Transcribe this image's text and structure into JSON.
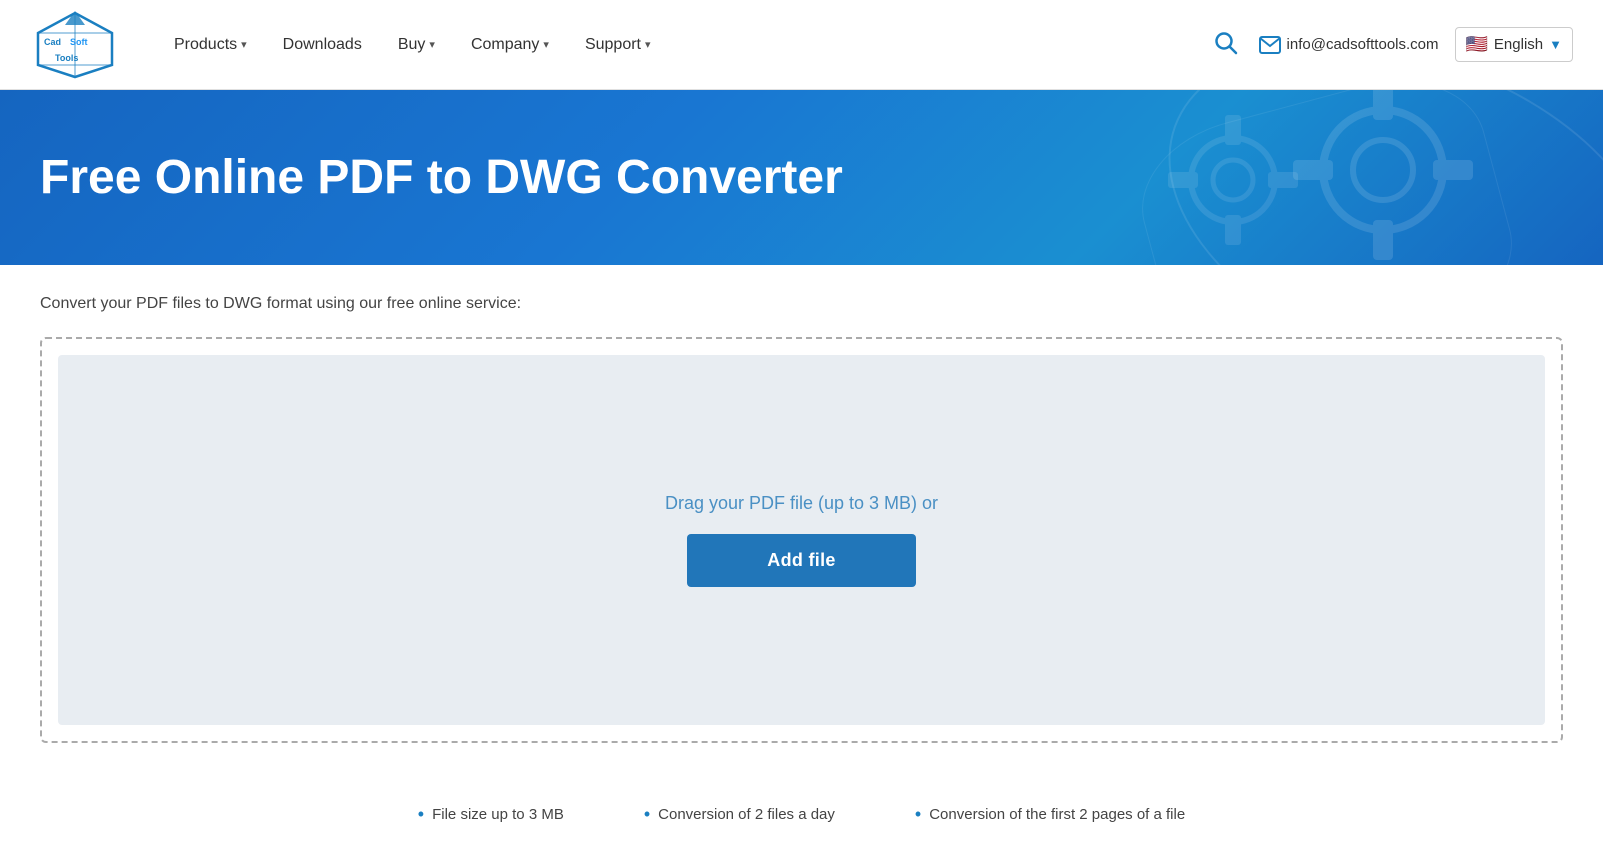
{
  "nav": {
    "logo_alt": "CadSoftTools Logo",
    "links": [
      {
        "label": "Products",
        "has_dropdown": true
      },
      {
        "label": "Downloads",
        "has_dropdown": false
      },
      {
        "label": "Buy",
        "has_dropdown": true
      },
      {
        "label": "Company",
        "has_dropdown": true
      },
      {
        "label": "Support",
        "has_dropdown": true
      }
    ],
    "email": "info@cadsofttools.com",
    "language": "English",
    "search_aria": "Search"
  },
  "hero": {
    "title": "Free Online PDF to DWG Converter"
  },
  "main": {
    "subtitle": "Convert your PDF files to DWG format using our free online service:",
    "drag_text": "Drag your PDF file (up to 3 MB) or",
    "add_file_label": "Add file"
  },
  "features": [
    {
      "text": "File size up to 3 MB"
    },
    {
      "text": "Conversion of 2 files a day"
    },
    {
      "text": "Conversion of the first 2 pages of a file"
    }
  ]
}
